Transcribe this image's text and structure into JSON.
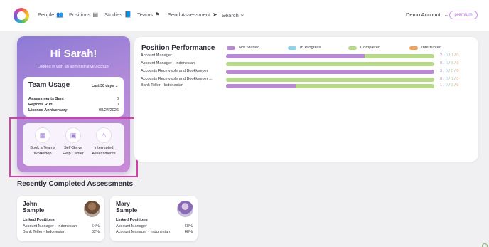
{
  "nav": {
    "items": [
      {
        "label": "People",
        "icon": "people-icon",
        "glyph": "👥"
      },
      {
        "label": "Positions",
        "icon": "positions-icon",
        "glyph": "▤"
      },
      {
        "label": "Studies",
        "icon": "studies-icon",
        "glyph": "📘"
      },
      {
        "label": "Teams",
        "icon": "teams-icon",
        "glyph": "⚑"
      },
      {
        "label": "Send Assessment",
        "icon": "send-icon",
        "glyph": "➤"
      },
      {
        "label": "Search",
        "icon": "search-icon",
        "glyph": "⌕"
      }
    ],
    "account_label": "Demo Account",
    "account_chevron": "⌄",
    "premium_badge": "premium"
  },
  "hero": {
    "title": "Hi Sarah!",
    "subtitle": "Logged in with an administrative account",
    "usage": {
      "title": "Team Usage",
      "range": "Last 30 days",
      "range_chevron": "⌄",
      "rows": [
        {
          "label": "Assessments Sent",
          "value": "0"
        },
        {
          "label": "Reports Run",
          "value": "0"
        },
        {
          "label": "License Anniversary",
          "value": "08/24/2026"
        }
      ]
    },
    "actions": [
      {
        "label_line1": "Book a Teams",
        "label_line2": "Workshop",
        "icon": "calendar-icon",
        "glyph": "▦"
      },
      {
        "label_line1": "Self-Serve",
        "label_line2": "Help Center",
        "icon": "help-center-icon",
        "glyph": "▣"
      },
      {
        "label_line1": "Interrupted",
        "label_line2": "Assessments",
        "icon": "warning-icon",
        "glyph": "⚠"
      }
    ]
  },
  "performance": {
    "title": "Position Performance",
    "legend": [
      {
        "label": "Not Started",
        "color": "#b98ad1"
      },
      {
        "label": "In Progress",
        "color": "#8fd3e8"
      },
      {
        "label": "Completed",
        "color": "#b7d98a"
      },
      {
        "label": "Interrupted",
        "color": "#f0a35e"
      }
    ],
    "rows": [
      {
        "label": "Account Manager",
        "not_started": 2,
        "in_progress": 0,
        "completed": 1,
        "interrupted": 0
      },
      {
        "label": "Account Manager - Indonesian",
        "not_started": 0,
        "in_progress": 0,
        "completed": 3,
        "interrupted": 0
      },
      {
        "label": "Accounts Receivable and Bookkeeper",
        "not_started": 3,
        "in_progress": 0,
        "completed": 0,
        "interrupted": 0
      },
      {
        "label": "Accounts Receivable and Bookkeeper ...",
        "not_started": 0,
        "in_progress": 0,
        "completed": 1,
        "interrupted": 0
      },
      {
        "label": "Bank Teller - Indonesian",
        "not_started": 1,
        "in_progress": 0,
        "completed": 2,
        "interrupted": 0
      }
    ]
  },
  "recent": {
    "title": "Recently Completed Assessments",
    "cards": [
      {
        "first": "John",
        "last": "Sample",
        "linked_label": "Linked Positions",
        "positions": [
          {
            "name": "Account Manager - Indonesian",
            "score": "64%"
          },
          {
            "name": "Bank Teller - Indonesian",
            "score": "82%"
          }
        ]
      },
      {
        "first": "Mary",
        "last": "Sample",
        "linked_label": "Linked Positions",
        "positions": [
          {
            "name": "Account Manager",
            "score": "68%"
          },
          {
            "name": "Account Manager - Indonesian",
            "score": "68%"
          }
        ]
      }
    ]
  }
}
